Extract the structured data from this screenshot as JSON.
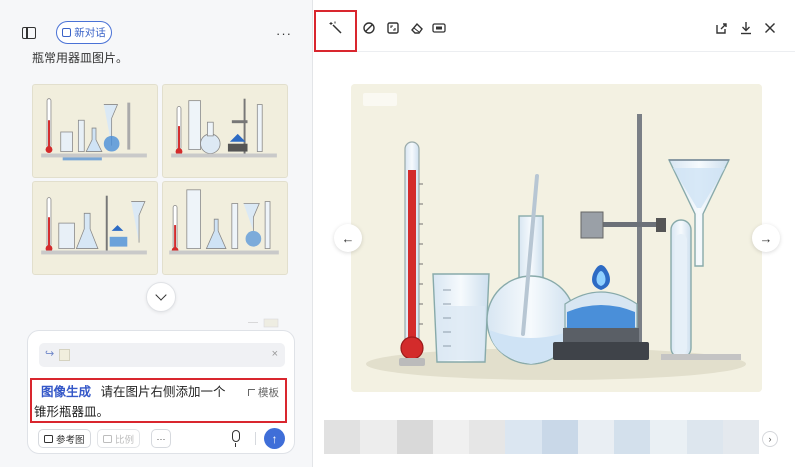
{
  "header": {
    "new_chat_label": "新对话",
    "more_label": "···"
  },
  "conversation": {
    "trailing_text": "瓶常用器皿图片。",
    "thumbnails": [
      {
        "name": "thumbnail-1"
      },
      {
        "name": "thumbnail-2"
      },
      {
        "name": "thumbnail-3"
      },
      {
        "name": "thumbnail-4"
      }
    ]
  },
  "composer": {
    "ref_arrow": "↪",
    "ref_close": "×",
    "skill_label": "图像生成",
    "prompt_line1": "请在图片右侧添加一个",
    "prompt_line2": "锥形瓶器皿。",
    "template_label": "模板",
    "ref_image_label": "参考图",
    "ratio_label": "比例",
    "more_label": "···",
    "send_icon": "↑"
  },
  "viewer": {
    "toolbar_left": [
      "magic-wand-icon",
      "no-edit-icon",
      "crop-icon",
      "eraser-icon",
      "hd-icon"
    ],
    "toolbar_right": [
      "share-icon",
      "download-icon",
      "close-icon"
    ],
    "prev_label": "←",
    "next_label": "→",
    "film_next_label": "›"
  },
  "colors": {
    "accent": "#3f6ed8",
    "highlight_red": "#d9262e",
    "canvas_bg": "#f3f1e2",
    "liquid_red": "#d32b2b",
    "liquid_blue": "#4a8fd9"
  }
}
